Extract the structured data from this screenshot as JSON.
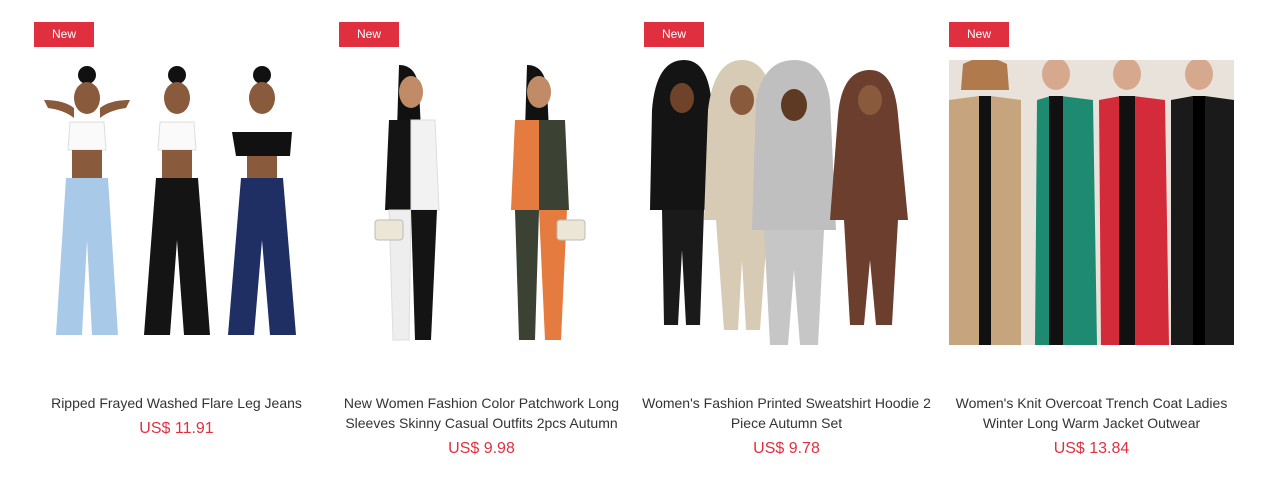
{
  "products": [
    {
      "badge": "New",
      "title": "Ripped Frayed Washed Flare Leg Jeans",
      "price": "US$ 11.91",
      "image": "three-models-flare-jeans"
    },
    {
      "badge": "New",
      "title": "New Women Fashion Color Patchwork Long Sleeves Skinny Casual Outfits 2pcs Autumn",
      "price": "US$ 9.98",
      "image": "two-models-patchwork-outfits"
    },
    {
      "badge": "New",
      "title": "Women's Fashion Printed Sweatshirt Hoodie 2 Piece Autumn Set",
      "price": "US$ 9.78",
      "image": "four-models-hoodie-sets"
    },
    {
      "badge": "New",
      "title": "Women's Knit Overcoat Trench Coat Ladies Winter Long Warm Jacket Outwear",
      "price": "US$ 13.84",
      "image": "four-models-overcoats"
    }
  ],
  "colors": {
    "badge_bg": "#e0303f",
    "price": "#e0303f",
    "title": "#333333"
  }
}
